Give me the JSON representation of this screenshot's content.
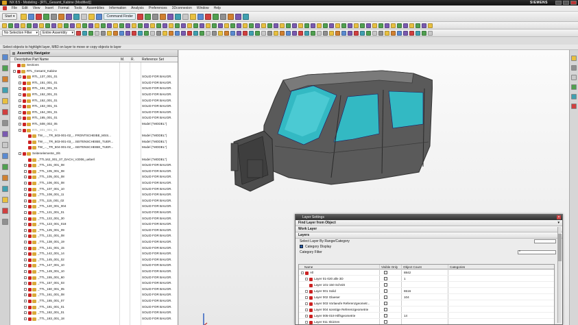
{
  "title_bar": {
    "title": "NX 8.5 - Modeling - [RTL_Gesamt_Kabine (Modified)]",
    "brand": "SIEMENS"
  },
  "menu": [
    "File",
    "Edit",
    "View",
    "Insert",
    "Format",
    "Tools",
    "Assemblies",
    "Information",
    "Analysis",
    "Preferences",
    "3Dconnexion",
    "Window",
    "Help"
  ],
  "toolbar": {
    "start_label": "Start ▾",
    "command_finder_label": "Command Finder",
    "selection_filter": "No Selection Filter",
    "scope": "Entire Assembly",
    "colors": [
      "#e8c040",
      "#5a8ad0",
      "#d04040",
      "#50a050",
      "#909090",
      "#d08030",
      "#7a5ab0",
      "#40a0b0",
      "#c8c8c8"
    ]
  },
  "cue_line": "Select objects to highlight layer, MB3 on layer to move or copy objects to layer",
  "navigator": {
    "title": "Assembly Navigator",
    "columns": {
      "name": "Descriptive Part Name",
      "modified": "M.",
      "r": "R.",
      "reference_set": "Reference Set"
    },
    "rows": [
      {
        "indent": 0,
        "name": "Sections",
        "ref": "",
        "tw": false,
        "dim": false
      },
      {
        "indent": 0,
        "name": "RTL_Gesamt_Kabine",
        "ref": "",
        "tw": true,
        "dim": false
      },
      {
        "indent": 1,
        "name": "RTL_137_001_01",
        "ref": "SOLID FOR BAUGR.",
        "tw": true,
        "dim": false
      },
      {
        "indent": 1,
        "name": "RTL_151_001_01",
        "ref": "SOLID FOR BAUGR.",
        "tw": true,
        "dim": false
      },
      {
        "indent": 1,
        "name": "RTL_151_001_01",
        "ref": "SOLID FOR BAUGR.",
        "tw": true,
        "dim": false
      },
      {
        "indent": 1,
        "name": "RTL_152_001_01",
        "ref": "SOLID FOR BAUGR.",
        "tw": true,
        "dim": false
      },
      {
        "indent": 1,
        "name": "RTL_152_001_01",
        "ref": "SOLID FOR BAUGR.",
        "tw": true,
        "dim": false
      },
      {
        "indent": 1,
        "name": "RTL_153_001_01",
        "ref": "SOLID FOR BAUGR.",
        "tw": true,
        "dim": false
      },
      {
        "indent": 1,
        "name": "RTL_154_001_01",
        "ref": "SOLID FOR BAUGR.",
        "tw": true,
        "dim": false
      },
      {
        "indent": 1,
        "name": "RTL_165_001_01",
        "ref": "SOLID FOR BAUGR.",
        "tw": true,
        "dim": false
      },
      {
        "indent": 1,
        "name": "RTL_508_002_05",
        "ref": "Model (\"MODEL\")",
        "tw": true,
        "dim": false
      },
      {
        "indent": 1,
        "name": "RTL_801_001_01",
        "ref": "",
        "tw": true,
        "dim": true
      },
      {
        "indent": 2,
        "name": "TW_..._TR_503-001-02_...FRONTSCHEIBE_MSS...",
        "ref": "Model (\"MODEL\")",
        "tw": false,
        "dim": false
      },
      {
        "indent": 2,
        "name": "TW_..._TR_503-001-03_...SEITENSCHEIBE_TUER...",
        "ref": "Model (\"MODEL\")",
        "tw": false,
        "dim": false
      },
      {
        "indent": 2,
        "name": "TW_..._TR_504-001-02_...SEITENSCHEIBE_TUER...",
        "ref": "Model (\"MODEL\")",
        "tw": false,
        "dim": false
      },
      {
        "indent": 1,
        "name": "Seitenelemente_2/6",
        "ref": "",
        "tw": true,
        "dim": false
      },
      {
        "indent": 2,
        "name": "_TTL162_001_07_DACH_V2006_ueberl",
        "ref": "Model (\"MODEL\")",
        "tw": false,
        "dim": false
      },
      {
        "indent": 2,
        "name": "_TTL_101_001_08",
        "ref": "SOLID FOR BAUGR.",
        "tw": true,
        "dim": false
      },
      {
        "indent": 2,
        "name": "_TTL_105_001_08",
        "ref": "SOLID FOR BAUGR.",
        "tw": true,
        "dim": false
      },
      {
        "indent": 2,
        "name": "_TTL_105_001_08",
        "ref": "SOLID FOR BAUGR.",
        "tw": true,
        "dim": false
      },
      {
        "indent": 2,
        "name": "_TTL_106_001_08",
        "ref": "SOLID FOR BAUGR.",
        "tw": true,
        "dim": false
      },
      {
        "indent": 2,
        "name": "_TTL_107_001_10",
        "ref": "SOLID FOR BAUGR.",
        "tw": true,
        "dim": false
      },
      {
        "indent": 2,
        "name": "_TTL_108_001_11",
        "ref": "SOLID FOR BAUGR.",
        "tw": true,
        "dim": false
      },
      {
        "indent": 2,
        "name": "_TTL_115_001_02",
        "ref": "SOLID FOR BAUGR.",
        "tw": true,
        "dim": false
      },
      {
        "indent": 2,
        "name": "_TTL_120_001_004",
        "ref": "SOLID FOR BAUGR.",
        "tw": true,
        "dim": false
      },
      {
        "indent": 2,
        "name": "_TTL_121_001_01",
        "ref": "SOLID FOR BAUGR.",
        "tw": true,
        "dim": false
      },
      {
        "indent": 2,
        "name": "_TTL_122_001_30",
        "ref": "SOLID FOR BAUGR.",
        "tw": true,
        "dim": false
      },
      {
        "indent": 2,
        "name": "_TTL_123_001_018",
        "ref": "SOLID FOR BAUGR.",
        "tw": true,
        "dim": false
      },
      {
        "indent": 2,
        "name": "_TTL_125_001_09",
        "ref": "SOLID FOR BAUGR.",
        "tw": true,
        "dim": false
      },
      {
        "indent": 2,
        "name": "_TTL_131_001_08",
        "ref": "SOLID FOR BAUGR.",
        "tw": true,
        "dim": false
      },
      {
        "indent": 2,
        "name": "_TTL_138_001_19",
        "ref": "SOLID FOR BAUGR.",
        "tw": true,
        "dim": false
      },
      {
        "indent": 2,
        "name": "_TTL_141_001_15",
        "ref": "SOLID FOR BAUGR.",
        "tw": true,
        "dim": false
      },
      {
        "indent": 2,
        "name": "_TTL_142_001_14",
        "ref": "SOLID FOR BAUGR.",
        "tw": true,
        "dim": false
      },
      {
        "indent": 2,
        "name": "_TTL_145_001_02",
        "ref": "SOLID FOR BAUGR.",
        "tw": true,
        "dim": false
      },
      {
        "indent": 2,
        "name": "_TTL_147_001_10",
        "ref": "SOLID FOR BAUGR.",
        "tw": true,
        "dim": false
      },
      {
        "indent": 2,
        "name": "_TTL_149_001_10",
        "ref": "SOLID FOR BAUGR.",
        "tw": true,
        "dim": false
      },
      {
        "indent": 2,
        "name": "_TTL_155_001_60",
        "ref": "SOLID FOR BAUGR.",
        "tw": true,
        "dim": false
      },
      {
        "indent": 2,
        "name": "_TTL_157_001_03",
        "ref": "SOLID FOR BAUGR.",
        "tw": true,
        "dim": false
      },
      {
        "indent": 2,
        "name": "_TTL_160_001_05",
        "ref": "SOLID FOR BAUGR.",
        "tw": true,
        "dim": false
      },
      {
        "indent": 2,
        "name": "_TTL_161_001_08",
        "ref": "SOLID FOR BAUGR.",
        "tw": true,
        "dim": false
      },
      {
        "indent": 2,
        "name": "_TTL_165_001_07",
        "ref": "SOLID FOR BAUGR.",
        "tw": true,
        "dim": false
      },
      {
        "indent": 2,
        "name": "_TTL_181_001_01",
        "ref": "SOLID FOR BAUGR.",
        "tw": true,
        "dim": false
      },
      {
        "indent": 2,
        "name": "_TTL_182_001_01",
        "ref": "SOLID FOR BAUGR.",
        "tw": true,
        "dim": false
      },
      {
        "indent": 2,
        "name": "_TTL_183_001_18",
        "ref": "SOLID FOR BAUGR.",
        "tw": true,
        "dim": false
      }
    ]
  },
  "layer_dialog": {
    "title": "Layer Settings",
    "groups": [
      "Find Layer from Object",
      "Work Layer",
      "Layers"
    ],
    "select_label": "Select Layer By Range/Category",
    "category_display": "Category Display",
    "category_filter": "Category Filter",
    "category_filter_value": "*",
    "columns": {
      "name": "Name",
      "visible": "Visible Only",
      "count": "Object Count",
      "categories": "Categories"
    },
    "rows": [
      {
        "indent": 0,
        "name": "All",
        "count": "8842",
        "tw": true
      },
      {
        "indent": 1,
        "name": "Layer 01-020 alle 3D",
        "count": "1",
        "tw": true
      },
      {
        "indent": 1,
        "name": "Layer 101-150 Schnitt",
        "count": "",
        "tw": false
      },
      {
        "indent": 1,
        "name": "Layer 001 Solid",
        "count": "6516",
        "tw": true
      },
      {
        "indent": 1,
        "name": "Layer 002 Glaeser",
        "count": "104",
        "tw": true
      },
      {
        "indent": 1,
        "name": "Layer 003 Vorlaeufe Referenzgeometr...",
        "count": "",
        "tw": true
      },
      {
        "indent": 1,
        "name": "Layer 004 sonstige Referenzgeometrie",
        "count": "",
        "tw": true
      },
      {
        "indent": 1,
        "name": "Layer 005-019 Hilfsgeometrie",
        "count": "14",
        "tw": true
      },
      {
        "indent": 1,
        "name": "Layer 011 Skizzen",
        "count": "",
        "tw": true
      }
    ]
  }
}
